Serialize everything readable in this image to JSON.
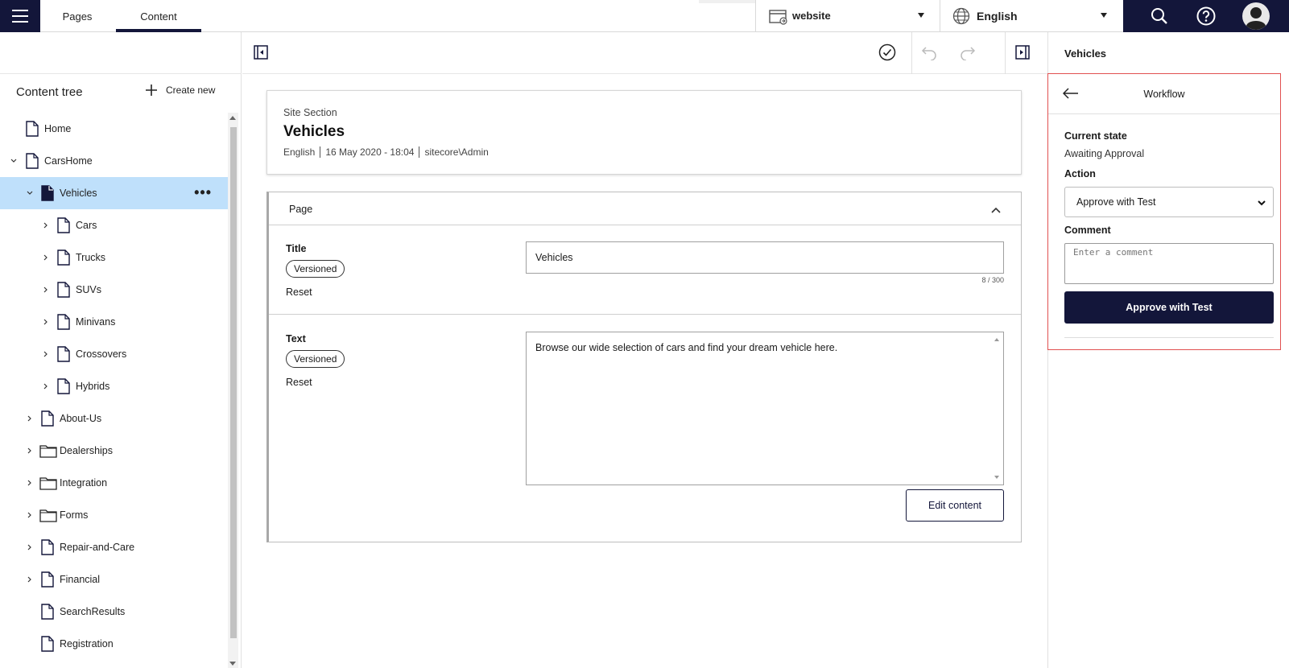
{
  "topbar": {
    "tabs": [
      {
        "label": "Pages"
      },
      {
        "label": "Content"
      }
    ],
    "site_selector": "website",
    "language_selector": "English"
  },
  "sidebar": {
    "title": "Content tree",
    "create_new": "Create new",
    "items": [
      {
        "label": "Home",
        "level": 1,
        "expander": "none",
        "icon": "page-icon"
      },
      {
        "label": "CarsHome",
        "level": 1,
        "expander": "expanded",
        "icon": "page-icon"
      },
      {
        "label": "Vehicles",
        "level": 2,
        "expander": "expanded",
        "icon": "page-icon",
        "selected": true
      },
      {
        "label": "Cars",
        "level": 3,
        "expander": "collapsed",
        "icon": "page-icon"
      },
      {
        "label": "Trucks",
        "level": 3,
        "expander": "collapsed",
        "icon": "page-icon"
      },
      {
        "label": "SUVs",
        "level": 3,
        "expander": "collapsed",
        "icon": "page-icon"
      },
      {
        "label": "Minivans",
        "level": 3,
        "expander": "collapsed",
        "icon": "page-icon"
      },
      {
        "label": "Crossovers",
        "level": 3,
        "expander": "collapsed",
        "icon": "page-icon"
      },
      {
        "label": "Hybrids",
        "level": 3,
        "expander": "collapsed",
        "icon": "page-icon"
      },
      {
        "label": "About-Us",
        "level": 2,
        "expander": "collapsed",
        "icon": "page-icon"
      },
      {
        "label": "Dealerships",
        "level": 2,
        "expander": "collapsed",
        "icon": "folder-icon"
      },
      {
        "label": "Integration",
        "level": 2,
        "expander": "collapsed",
        "icon": "folder-icon"
      },
      {
        "label": "Forms",
        "level": 2,
        "expander": "collapsed",
        "icon": "folder-icon"
      },
      {
        "label": "Repair-and-Care",
        "level": 2,
        "expander": "collapsed",
        "icon": "page-icon"
      },
      {
        "label": "Financial",
        "level": 2,
        "expander": "collapsed",
        "icon": "page-icon"
      },
      {
        "label": "SearchResults",
        "level": 2,
        "expander": "none",
        "icon": "page-icon"
      },
      {
        "label": "Registration",
        "level": 2,
        "expander": "none",
        "icon": "page-icon"
      }
    ]
  },
  "item": {
    "template": "Site Section",
    "name": "Vehicles",
    "language": "English",
    "date": "16 May 2020 - 18:04",
    "author": "sitecore\\Admin"
  },
  "section": {
    "title": "Page",
    "fields": {
      "title": {
        "label": "Title",
        "badge": "Versioned",
        "reset": "Reset",
        "value": "Vehicles",
        "counter": "8 / 300"
      },
      "text": {
        "label": "Text",
        "badge": "Versioned",
        "reset": "Reset",
        "value": "Browse our wide selection of cars and find your dream vehicle here."
      }
    },
    "edit_button": "Edit content"
  },
  "right_panel": {
    "title": "Vehicles",
    "workflow": {
      "title": "Workflow",
      "current_state_label": "Current state",
      "current_state": "Awaiting Approval",
      "action_label": "Action",
      "action_value": "Approve with Test",
      "comment_label": "Comment",
      "comment_placeholder": "Enter a comment",
      "submit_label": "Approve with Test"
    }
  },
  "colors": {
    "brand_navy": "#13163a",
    "selected_row": "#bfe0fb",
    "highlight_border": "#e15050"
  }
}
